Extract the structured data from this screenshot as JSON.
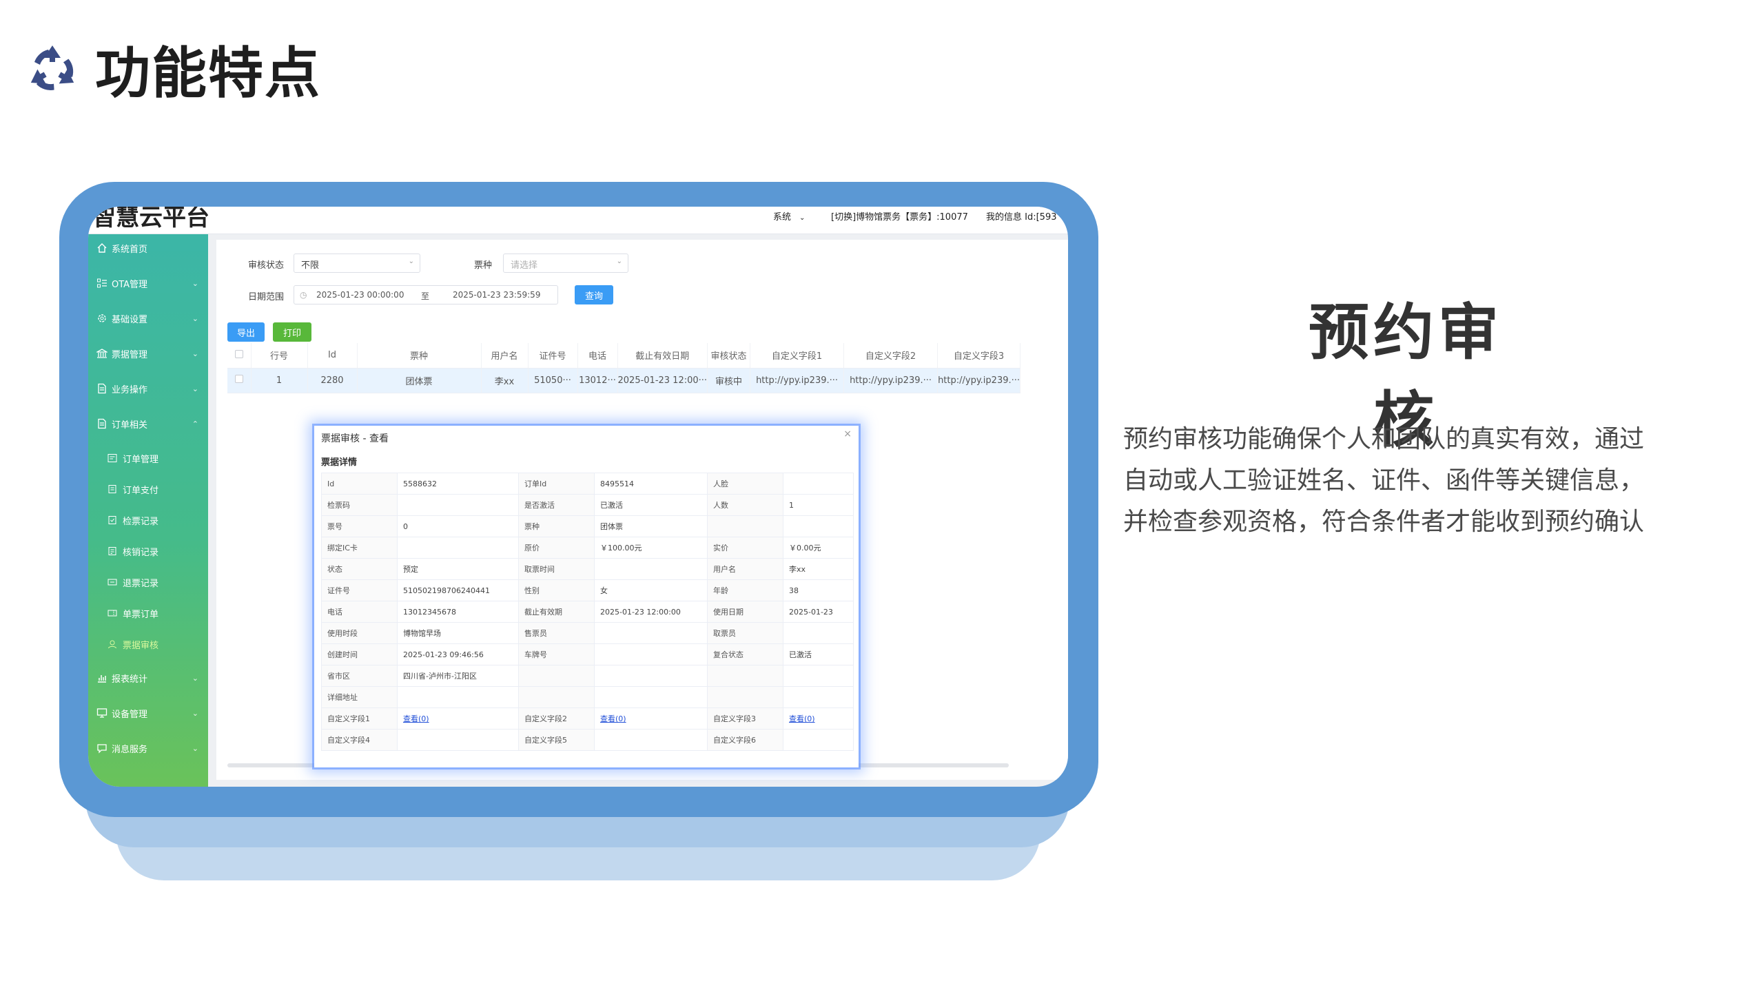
{
  "slide": {
    "title": "功能特点",
    "feature_title": "预约审核",
    "feature_desc_lines": [
      "预约审核功能确保个人和团队的真实有效，通过",
      "自动或人工验证姓名、证件、函件等关键信息，",
      "并检查参观资格，符合条件者才能收到预约确认"
    ]
  },
  "colors": {
    "frame": "#5b98d4",
    "sidebar_top": "#3cb6a7",
    "sidebar_bottom": "#6ac25a",
    "primary_button": "#3a9cf5",
    "print_button": "#58b83a",
    "link": "#2250d8"
  },
  "app": {
    "brand": "智慧云平台",
    "top_menu": {
      "system": "系统",
      "switch": "[切换]博物馆票务【票务】:10077",
      "my_info": "我的信息 Id:[593"
    }
  },
  "sidebar": {
    "items": [
      {
        "label": "系统首页",
        "icon": "home-icon"
      },
      {
        "label": "OTA管理",
        "icon": "list-icon"
      },
      {
        "label": "基础设置",
        "icon": "gear-icon"
      },
      {
        "label": "票据管理",
        "icon": "bank-icon"
      },
      {
        "label": "业务操作",
        "icon": "document-icon"
      },
      {
        "label": "订单相关",
        "icon": "document-icon"
      },
      {
        "label": "报表统计",
        "icon": "chart-icon"
      },
      {
        "label": "设备管理",
        "icon": "monitor-icon"
      },
      {
        "label": "消息服务",
        "icon": "message-icon"
      }
    ],
    "sub_items": [
      {
        "label": "订单管理",
        "icon": "order-icon"
      },
      {
        "label": "订单支付",
        "icon": "payment-icon"
      },
      {
        "label": "检票记录",
        "icon": "check-icon"
      },
      {
        "label": "核销记录",
        "icon": "verify-icon"
      },
      {
        "label": "退票记录",
        "icon": "refund-icon"
      },
      {
        "label": "单票订单",
        "icon": "ticket-icon"
      },
      {
        "label": "票据审核",
        "icon": "user-icon"
      }
    ]
  },
  "filters": {
    "status_label": "审核状态",
    "status_value": "不限",
    "ticket_label": "票种",
    "ticket_placeholder": "请选择",
    "date_label": "日期范围",
    "date_start": "2025-01-23 00:00:00",
    "date_sep": "至",
    "date_end": "2025-01-23 23:59:59",
    "query_button": "查询"
  },
  "actions": {
    "export": "导出",
    "print": "打印"
  },
  "table": {
    "headers": [
      "行号",
      "Id",
      "票种",
      "用户名",
      "证件号",
      "电话",
      "截止有效日期",
      "审核状态",
      "自定义字段1",
      "自定义字段2",
      "自定义字段3"
    ],
    "rows": [
      [
        "1",
        "2280",
        "团体票",
        "李xx",
        "51050···",
        "13012···",
        "2025-01-23 12:00···",
        "审核中",
        "http://ypy.ip239.···",
        "http://ypy.ip239.···",
        "http://ypy.ip239.···"
      ]
    ]
  },
  "dialog": {
    "title": "票据审核 - 查看",
    "close": "×",
    "section": "票据详情",
    "rows": [
      [
        "Id",
        "5588632",
        "订单Id",
        "8495514",
        "人脸",
        ""
      ],
      [
        "检票码",
        "",
        "是否激活",
        "已激活",
        "人数",
        "1"
      ],
      [
        "票号",
        "0",
        "票种",
        "团体票",
        "",
        ""
      ],
      [
        "绑定IC卡",
        "",
        "原价",
        "￥100.00元",
        "实价",
        "￥0.00元"
      ],
      [
        "状态",
        "预定",
        "取票时间",
        "",
        "用户名",
        "李xx"
      ],
      [
        "证件号",
        "510502198706240441",
        "性别",
        "女",
        "年龄",
        "38"
      ],
      [
        "电话",
        "13012345678",
        "截止有效期",
        "2025-01-23 12:00:00",
        "使用日期",
        "2025-01-23"
      ],
      [
        "使用时段",
        "博物馆早场",
        "售票员",
        "",
        "取票员",
        ""
      ],
      [
        "创建时间",
        "2025-01-23 09:46:56",
        "车牌号",
        "",
        "复合状态",
        "已激活"
      ],
      [
        "省市区",
        "四川省-泸州市-江阳区",
        "",
        "",
        "",
        ""
      ],
      [
        "详细地址",
        "",
        "",
        "",
        "",
        ""
      ],
      [
        "自定义字段1",
        "查看(0)",
        "自定义字段2",
        "查看(0)",
        "自定义字段3",
        "查看(0)"
      ],
      [
        "自定义字段4",
        "",
        "自定义字段5",
        "",
        "自定义字段6",
        ""
      ]
    ]
  }
}
